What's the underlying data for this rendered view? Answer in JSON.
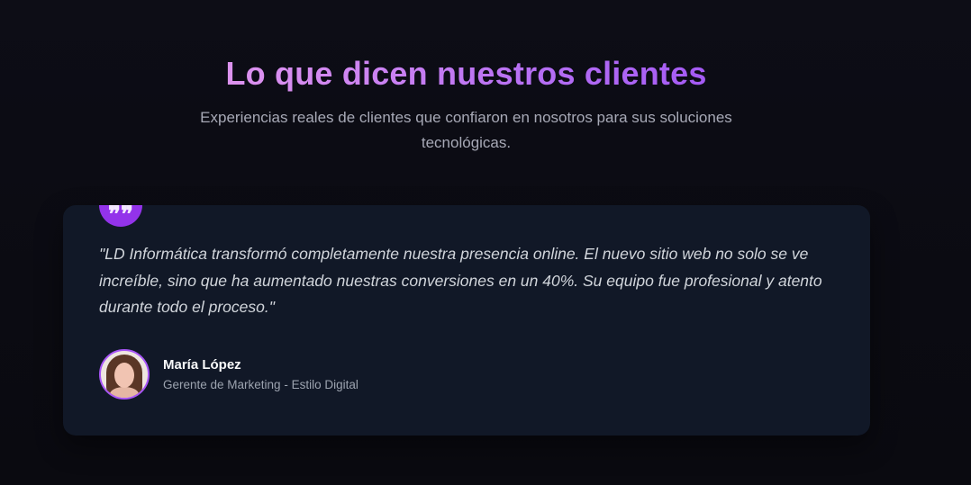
{
  "section": {
    "title": "Lo que dicen nuestros clientes",
    "subtitle": "Experiencias reales de clientes que confiaron en nosotros para sus soluciones tecnológicas.",
    "accent_color": "#9333ea",
    "title_gradient": [
      "#f0a8e6",
      "#8e3ff5"
    ]
  },
  "testimonial": {
    "quote_icon": "quote-icon",
    "quote_glyph": "99",
    "text": "\"LD Informática transformó completamente nuestra presencia online. El nuevo sitio web no solo se ve increíble, sino que ha aumentado nuestras conversiones en un 40%. Su equipo fue profesional y atento durante todo el proceso.\"",
    "author": {
      "name": "María López",
      "role": "Gerente de Marketing - Estilo Digital",
      "avatar": "avatar-photo"
    }
  }
}
